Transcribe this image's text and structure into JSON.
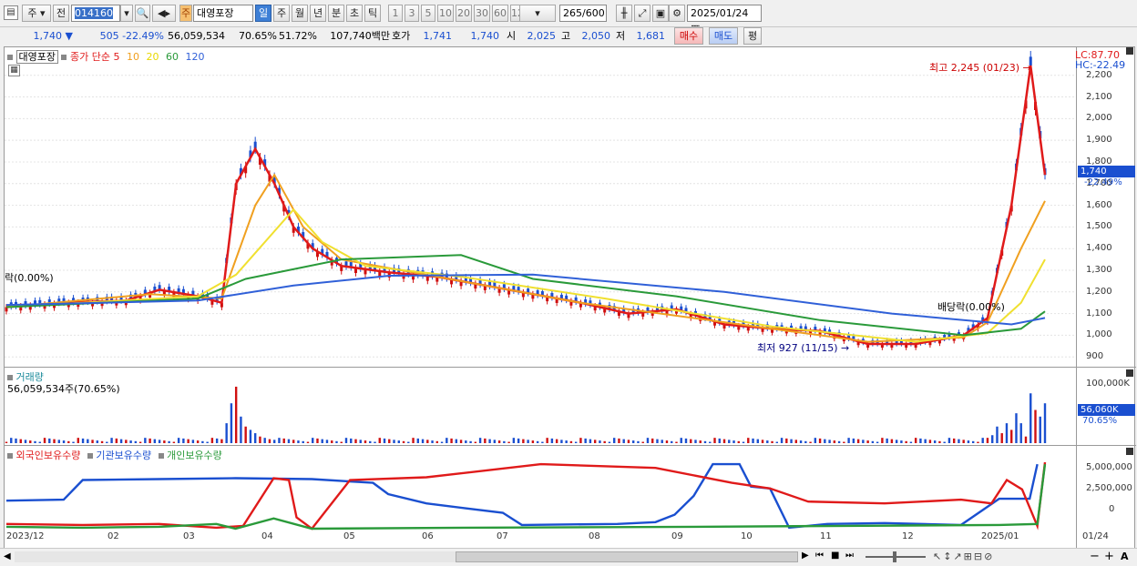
{
  "toolbar": {
    "market_sel": "주",
    "prev_label": "전",
    "code": "014160",
    "stock_badge": "주",
    "stock_name": "대영포장",
    "periods": [
      "일",
      "주",
      "월",
      "년",
      "분",
      "초",
      "틱"
    ],
    "minutes": [
      "1",
      "3",
      "5",
      "10",
      "20",
      "30",
      "60",
      "120"
    ],
    "count": "265",
    "total": "/600",
    "date": "2025/01/24"
  },
  "quote": {
    "price": "1,740",
    "change": "505",
    "change_pct": "-22.49%",
    "volume": "56,059,534",
    "vol_pct": "70.65%",
    "ratio": "51.72%",
    "amount": "107,740백만",
    "hoga_label": "호가",
    "bid": "1,741",
    "ask": "1,740",
    "open_label": "시",
    "open": "2,025",
    "high_label": "고",
    "high": "2,050",
    "low_label": "저",
    "low": "1,681",
    "buy": "매수",
    "sell": "매도",
    "eval": "평"
  },
  "price_panel": {
    "name": "대영포장",
    "close_label": "종가 단순",
    "ma": [
      "5",
      "10",
      "20",
      "60",
      "120"
    ],
    "ma_colors": [
      "#e01a1a",
      "#f0a020",
      "#f0e030",
      "#2a9a3a",
      "#3060d8"
    ],
    "lc": "LC:87.70",
    "hc": "HC:-22.49",
    "high_note": "최고 2,245 (01/23)",
    "low_note": "최저 927 (11/15)",
    "left_note": "락(0.00%)",
    "div_note": "배당락(0.00%)",
    "cur_price": "1,740",
    "cur_pct": "-22.49%",
    "yticks": [
      "2,200",
      "2,100",
      "2,000",
      "1,900",
      "1,800",
      "1,700",
      "1,600",
      "1,500",
      "1,400",
      "1,300",
      "1,200",
      "1,100",
      "1,000",
      "900"
    ]
  },
  "volume_panel": {
    "title": "거래량",
    "value": "56,059,534주(70.65%)",
    "ytick": "100,000K",
    "cur": "56,060K",
    "cur_pct": "70.65%"
  },
  "holder_panel": {
    "foreign": "외국인보유수량",
    "inst": "기관보유수량",
    "indiv": "개인보유수량",
    "yticks": [
      "5,000,000",
      "2,500,000",
      "0"
    ]
  },
  "xaxis": [
    "2023/12",
    "02",
    "03",
    "04",
    "05",
    "06",
    "07",
    "08",
    "09",
    "10",
    "11",
    "12",
    "2025/01",
    "01/24"
  ],
  "chart_data": {
    "type": "line",
    "series": [
      {
        "name": "종가 단순 5",
        "color": "#e01a1a",
        "points": [
          [
            0,
            1130
          ],
          [
            12,
            1150
          ],
          [
            25,
            1160
          ],
          [
            32,
            1210
          ],
          [
            40,
            1180
          ],
          [
            45,
            1150
          ],
          [
            48,
            1700
          ],
          [
            52,
            1860
          ],
          [
            56,
            1700
          ],
          [
            60,
            1500
          ],
          [
            64,
            1400
          ],
          [
            70,
            1320
          ],
          [
            80,
            1290
          ],
          [
            90,
            1270
          ],
          [
            100,
            1230
          ],
          [
            110,
            1190
          ],
          [
            120,
            1150
          ],
          [
            130,
            1100
          ],
          [
            140,
            1120
          ],
          [
            150,
            1050
          ],
          [
            160,
            1030
          ],
          [
            170,
            1020
          ],
          [
            180,
            960
          ],
          [
            190,
            960
          ],
          [
            200,
            1000
          ],
          [
            205,
            1080
          ],
          [
            210,
            1600
          ],
          [
            214,
            2245
          ],
          [
            217,
            1740
          ]
        ]
      },
      {
        "name": "10",
        "color": "#f0a020",
        "points": [
          [
            0,
            1130
          ],
          [
            30,
            1190
          ],
          [
            45,
            1170
          ],
          [
            52,
            1600
          ],
          [
            56,
            1740
          ],
          [
            62,
            1500
          ],
          [
            70,
            1350
          ],
          [
            90,
            1270
          ],
          [
            120,
            1150
          ],
          [
            150,
            1060
          ],
          [
            180,
            970
          ],
          [
            200,
            990
          ],
          [
            205,
            1060
          ],
          [
            212,
            1400
          ],
          [
            217,
            1620
          ]
        ]
      },
      {
        "name": "20",
        "color": "#f0e030",
        "points": [
          [
            0,
            1130
          ],
          [
            40,
            1180
          ],
          [
            48,
            1280
          ],
          [
            60,
            1580
          ],
          [
            66,
            1430
          ],
          [
            75,
            1320
          ],
          [
            95,
            1270
          ],
          [
            125,
            1170
          ],
          [
            160,
            1040
          ],
          [
            190,
            970
          ],
          [
            205,
            1010
          ],
          [
            212,
            1150
          ],
          [
            217,
            1350
          ]
        ]
      },
      {
        "name": "60",
        "color": "#2a9a3a",
        "points": [
          [
            0,
            1130
          ],
          [
            40,
            1170
          ],
          [
            50,
            1260
          ],
          [
            70,
            1350
          ],
          [
            95,
            1370
          ],
          [
            110,
            1260
          ],
          [
            140,
            1180
          ],
          [
            170,
            1070
          ],
          [
            200,
            1000
          ],
          [
            212,
            1030
          ],
          [
            217,
            1110
          ]
        ]
      },
      {
        "name": "120",
        "color": "#3060d8",
        "points": [
          [
            0,
            1140
          ],
          [
            40,
            1160
          ],
          [
            60,
            1230
          ],
          [
            80,
            1275
          ],
          [
            110,
            1280
          ],
          [
            150,
            1200
          ],
          [
            185,
            1100
          ],
          [
            210,
            1050
          ],
          [
            217,
            1080
          ]
        ]
      }
    ]
  }
}
